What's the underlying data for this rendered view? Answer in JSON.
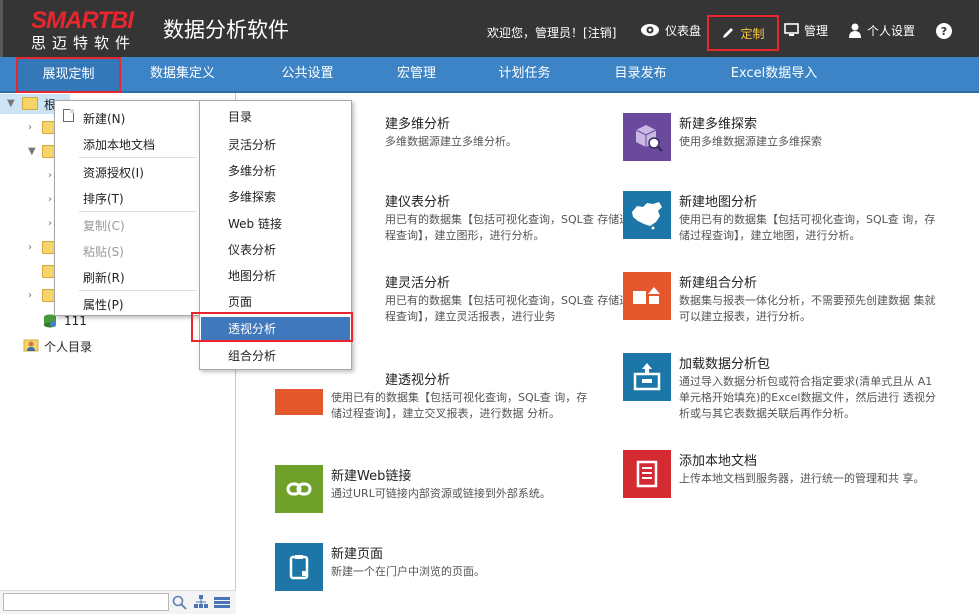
{
  "header": {
    "brand": "SMARTBI",
    "brand_cn": "思迈特软件",
    "app_title": "数据分析软件",
    "welcome": "欢迎您，管理员！[",
    "logout": "注销",
    "welcome_end": "]",
    "buttons": {
      "dashboard": "仪表盘",
      "customize": "定制",
      "manage": "管理",
      "settings": "个人设置",
      "help": "?"
    }
  },
  "nav": [
    "展现定制",
    "数据集定义",
    "公共设置",
    "宏管理",
    "计划任务",
    "目录发布",
    "Excel数据导入"
  ],
  "tree": {
    "root": "根",
    "item_111": "111",
    "personal": "个人目录"
  },
  "context_menu": {
    "items": [
      "新建(N)",
      "添加本地文档",
      "资源授权(I)",
      "排序(T)",
      "复制(C)",
      "粘贴(S)",
      "刷新(R)",
      "属性(P)"
    ]
  },
  "submenu": {
    "items": [
      "目录",
      "灵活分析",
      "多维分析",
      "多维探索",
      "Web 链接",
      "仪表分析",
      "地图分析",
      "页面",
      "透视分析",
      "组合分析"
    ]
  },
  "cards": [
    {
      "title": "建多维分析",
      "desc": "多维数据源建立多维分析。",
      "color": "#e5572c"
    },
    {
      "title": "建仪表分析",
      "desc": "用已有的数据集【包括可视化查询，SQL查 存储过程查询】，建立图形，进行分析。",
      "color": "#e5572c"
    },
    {
      "title": "建灵活分析",
      "desc": "用已有的数据集【包括可视化查询，SQL查 存储过程查询】，建立灵活报表，进行业务",
      "color": "#e5572c"
    },
    {
      "title": "建透视分析",
      "desc": "使用已有的数据集【包括可视化查询，SQL查 询，存储过程查询】，建立交叉报表，进行数据 分析。",
      "color": "#e5572c"
    },
    {
      "title": "新建Web链接",
      "desc": "通过URL可链接内部资源或链接到外部系统。",
      "color": "#6fa12a"
    },
    {
      "title": "新建页面",
      "desc": "新建一个在门户中浏览的页面。",
      "color": "#1c76a8"
    },
    {
      "title": "新建多维探索",
      "desc": "使用多维数据源建立多维探索",
      "color": "#6b4a9e"
    },
    {
      "title": "新建地图分析",
      "desc": "使用已有的数据集【包括可视化查询，SQL查 询，存储过程查询】，建立地图，进行分析。",
      "color": "#1c76a8"
    },
    {
      "title": "新建组合分析",
      "desc": "数据集与报表一体化分析，不需要预先创建数据 集就可以建立报表，进行分析。",
      "color": "#e5572c"
    },
    {
      "title": "加载数据分析包",
      "desc": "通过导入数据分析包或符合指定要求(清单式且从 A1单元格开始填充)的Excel数据文件，然后进行 透视分析或与其它表数据关联后再作分析。",
      "color": "#1c76a8"
    },
    {
      "title": "添加本地文档",
      "desc": "上传本地文档到服务器，进行统一的管理和共 享。",
      "color": "#d42b32"
    }
  ]
}
